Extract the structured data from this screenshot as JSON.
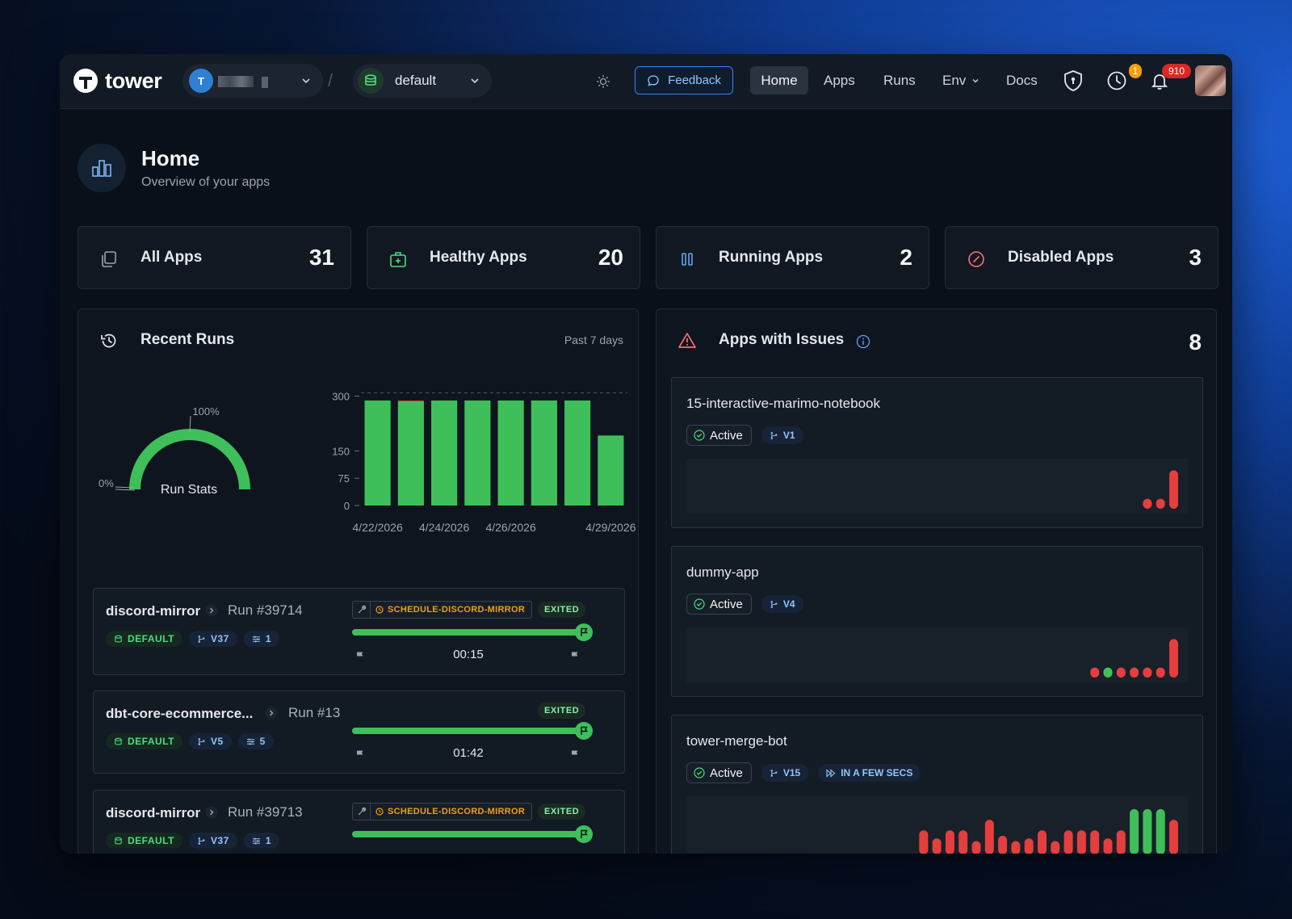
{
  "topbar": {
    "brand": "tower",
    "team_initial": "T",
    "environment": "default",
    "feedback_label": "Feedback",
    "nav": [
      "Home",
      "Apps",
      "Runs",
      "Env",
      "Docs"
    ],
    "active_nav": "Home",
    "clock_badge": "1",
    "notification_badge": "910"
  },
  "header": {
    "title": "Home",
    "subtitle": "Overview of your apps"
  },
  "stats": [
    {
      "label": "All Apps",
      "value": "31",
      "icon": "copy-icon"
    },
    {
      "label": "Healthy Apps",
      "value": "20",
      "icon": "medkit-icon"
    },
    {
      "label": "Running Apps",
      "value": "2",
      "icon": "pause-icon"
    },
    {
      "label": "Disabled Apps",
      "value": "3",
      "icon": "ban-icon"
    }
  ],
  "recent_runs": {
    "title": "Recent Runs",
    "range": "Past 7 days",
    "gauge": {
      "label": "Run Stats",
      "max_label": "100%",
      "min_label": "0%",
      "success_fraction": 1.0
    },
    "runs": [
      {
        "app": "discord-mirror",
        "run": "Run #39714",
        "tags": [
          "DEFAULT",
          "V37",
          "1"
        ],
        "schedule": "SCHEDULE-DISCORD-MIRROR",
        "status": "EXITED",
        "duration": "00:15",
        "progress": 1.0
      },
      {
        "app": "dbt-core-ecommerce...",
        "run": "Run #13",
        "tags": [
          "DEFAULT",
          "V5",
          "5"
        ],
        "schedule": "",
        "status": "EXITED",
        "duration": "01:42",
        "progress": 1.0
      },
      {
        "app": "discord-mirror",
        "run": "Run #39713",
        "tags": [
          "DEFAULT",
          "V37",
          "1"
        ],
        "schedule": "SCHEDULE-DISCORD-MIRROR",
        "status": "EXITED",
        "duration": "",
        "progress": 1.0
      }
    ]
  },
  "chart_data": {
    "type": "bar",
    "categories": [
      "4/22/2026",
      "4/23/2026",
      "4/24/2026",
      "4/25/2026",
      "4/26/2026",
      "4/27/2026",
      "4/28/2026",
      "4/29/2026"
    ],
    "x_tick_labels": [
      "4/22/2026",
      "4/24/2026",
      "4/26/2026",
      "4/29/2026"
    ],
    "series": [
      {
        "color": "#3fbf5a",
        "values": [
          288,
          286,
          288,
          288,
          288,
          288,
          288,
          192
        ]
      },
      {
        "color": "#e53e3e",
        "values": [
          0,
          2,
          0,
          0,
          0,
          0,
          0,
          0
        ]
      }
    ],
    "y_ticks": [
      0,
      75,
      150,
      300
    ],
    "ylim": [
      0,
      310
    ],
    "stacked": true
  },
  "issues": {
    "title": "Apps with Issues",
    "count": "8",
    "apps": [
      {
        "name": "15-interactive-marimo-notebook",
        "status": "Active",
        "version": "V1",
        "extra": "",
        "runs": [
          {
            "v": 0.22,
            "ok": false
          },
          {
            "v": 0.22,
            "ok": false
          },
          {
            "v": 0.85,
            "ok": false
          }
        ]
      },
      {
        "name": "dummy-app",
        "status": "Active",
        "version": "V4",
        "extra": "",
        "runs": [
          {
            "v": 0.22,
            "ok": false
          },
          {
            "v": 0.22,
            "ok": true
          },
          {
            "v": 0.22,
            "ok": false
          },
          {
            "v": 0.22,
            "ok": false
          },
          {
            "v": 0.22,
            "ok": false
          },
          {
            "v": 0.22,
            "ok": false
          },
          {
            "v": 0.85,
            "ok": false
          }
        ]
      },
      {
        "name": "tower-merge-bot",
        "status": "Active",
        "version": "V15",
        "extra": "IN A FEW SECS",
        "runs": [
          {
            "v": 0.45,
            "ok": false
          },
          {
            "v": 0.3,
            "ok": false
          },
          {
            "v": 0.45,
            "ok": false
          },
          {
            "v": 0.45,
            "ok": false
          },
          {
            "v": 0.25,
            "ok": false
          },
          {
            "v": 0.65,
            "ok": false
          },
          {
            "v": 0.35,
            "ok": false
          },
          {
            "v": 0.25,
            "ok": false
          },
          {
            "v": 0.3,
            "ok": false
          },
          {
            "v": 0.45,
            "ok": false
          },
          {
            "v": 0.25,
            "ok": false
          },
          {
            "v": 0.45,
            "ok": false
          },
          {
            "v": 0.45,
            "ok": false
          },
          {
            "v": 0.45,
            "ok": false
          },
          {
            "v": 0.3,
            "ok": false
          },
          {
            "v": 0.45,
            "ok": false
          },
          {
            "v": 0.85,
            "ok": true
          },
          {
            "v": 0.85,
            "ok": true
          },
          {
            "v": 0.85,
            "ok": true
          },
          {
            "v": 0.65,
            "ok": false
          }
        ]
      }
    ]
  }
}
